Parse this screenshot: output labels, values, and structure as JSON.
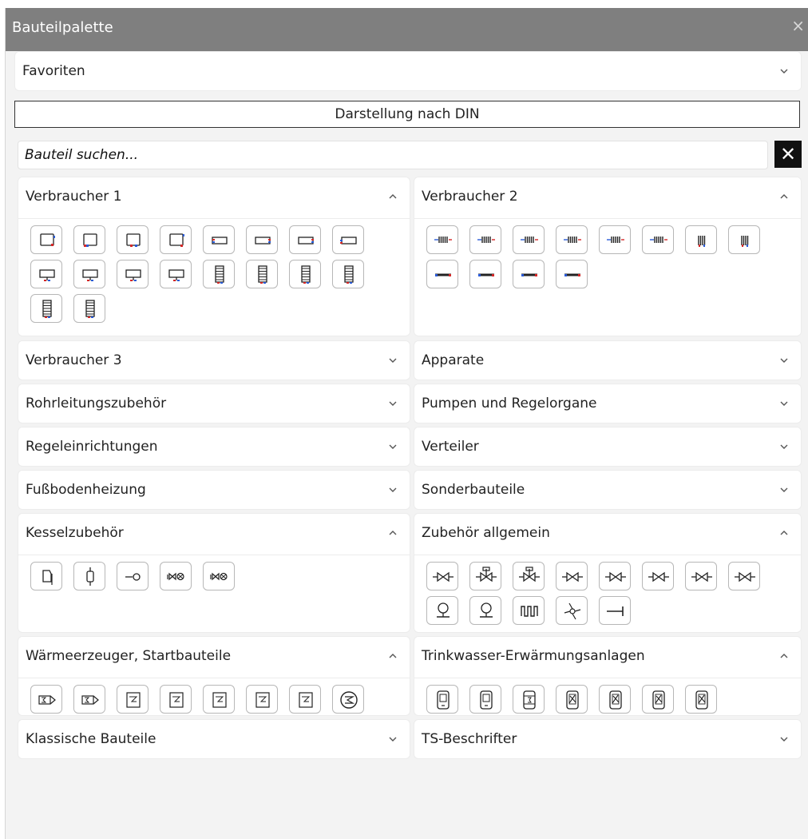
{
  "window": {
    "title": "Bauteilpalette",
    "close_glyph": "×"
  },
  "favorites": {
    "label": "Favoriten"
  },
  "din_button": {
    "label": "Darstellung nach DIN"
  },
  "search": {
    "placeholder": "Bauteil suchen...",
    "value": "",
    "clear_glyph": "✕"
  },
  "sections": {
    "verbraucher1": {
      "label": "Verbraucher 1",
      "expanded": true,
      "icons": [
        "radiator-left-icon",
        "radiator-bottom-left-icon",
        "radiator-bottom-icon",
        "radiator-right-icon",
        "convector-red-icon",
        "convector-icon",
        "convector-right-icon",
        "convector-left-icon",
        "floor-convector-icon",
        "floor-convector-2-icon",
        "floor-convector-3-icon",
        "floor-convector-4-icon",
        "tower-radiator-icon",
        "tower-radiator-2-icon",
        "tower-radiator-3-icon",
        "tower-radiator-4-icon",
        "tower-radiator-5-icon",
        "tower-radiator-6-icon"
      ]
    },
    "verbraucher2": {
      "label": "Verbraucher 2",
      "expanded": true,
      "icons": [
        "sectional-radiator-icon",
        "sectional-radiator-2-icon",
        "sectional-radiator-3-icon",
        "sectional-radiator-4-icon",
        "sectional-radiator-5-icon",
        "sectional-radiator-6-icon",
        "sectional-radiator-7-icon",
        "sectional-radiator-8-icon",
        "pipe-coil-icon",
        "pipe-coil-2-icon",
        "pipe-coil-3-icon",
        "pipe-coil-4-icon"
      ]
    },
    "verbraucher3": {
      "label": "Verbraucher 3",
      "expanded": false
    },
    "apparate": {
      "label": "Apparate",
      "expanded": false
    },
    "rohrleitungszubehoer": {
      "label": "Rohrleitungszubehör",
      "expanded": false
    },
    "pumpen": {
      "label": "Pumpen und Regelorgane",
      "expanded": false
    },
    "regeleinrichtungen": {
      "label": "Regeleinrichtungen",
      "expanded": false
    },
    "verteiler": {
      "label": "Verteiler",
      "expanded": false
    },
    "fussbodenheizung": {
      "label": "Fußbodenheizung",
      "expanded": false
    },
    "sonderbauteile": {
      "label": "Sonderbauteile",
      "expanded": false
    },
    "kesselzubehoer": {
      "label": "Kesselzubehör",
      "expanded": true,
      "icons": [
        "expansion-vessel-icon",
        "safety-valve-icon",
        "sensor-probe-icon",
        "boiler-valve-icon",
        "boiler-valve-2-icon"
      ]
    },
    "zubehoer": {
      "label": "Zubehör allgemein",
      "expanded": true,
      "icons": [
        "valve-icon",
        "valve-2-icon",
        "valve-3-icon",
        "valve-4-icon",
        "valve-5-icon",
        "valve-6-icon",
        "valve-7-icon",
        "valve-8-icon",
        "gauge-icon",
        "gauge-2-icon",
        "heating-coil-icon",
        "fan-icon",
        "arrow-right-icon"
      ]
    },
    "waermeerzeuger": {
      "label": "Wärmeerzeuger, Startbauteile",
      "expanded": true,
      "icons": [
        "heat-source-icon",
        "heat-source-2-icon",
        "boiler-icon",
        "boiler-2-icon",
        "boiler-3-icon",
        "boiler-4-icon",
        "boiler-5-icon",
        "heat-pump-icon"
      ]
    },
    "trinkwasser": {
      "label": "Trinkwasser-Erwärmungsanlagen",
      "expanded": true,
      "icons": [
        "water-heater-icon",
        "water-heater-2-icon",
        "water-heater-3-icon",
        "water-heater-4-icon",
        "water-heater-5-icon",
        "water-heater-6-icon",
        "water-heater-7-icon"
      ]
    },
    "klassische": {
      "label": "Klassische Bauteile",
      "expanded": false
    },
    "ts_beschrifter": {
      "label": "TS-Beschrifter",
      "expanded": false
    }
  },
  "colors": {
    "title_bar": "#7f7f7f",
    "red": "#d62828",
    "blue": "#2a5bd7"
  }
}
